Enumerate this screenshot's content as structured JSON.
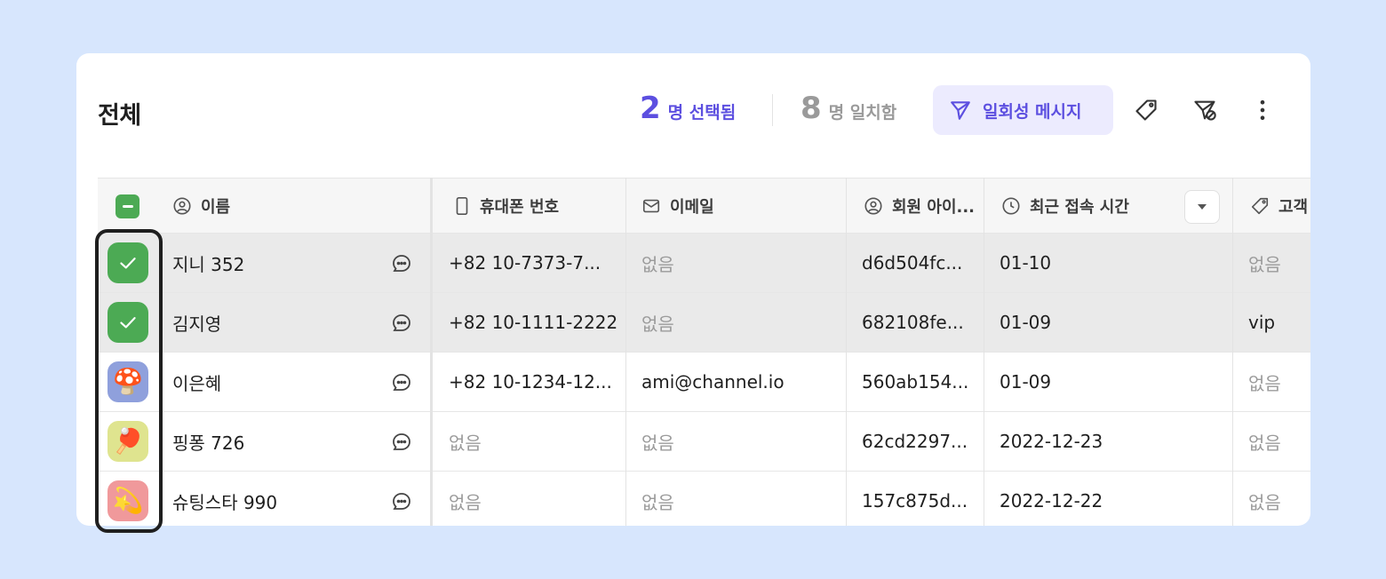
{
  "header": {
    "title": "전체",
    "selected_count": "2",
    "selected_label": "명 선택됨",
    "matched_count": "8",
    "matched_label": "명 일치함",
    "send_message_label": "일회성 메시지"
  },
  "icons": {
    "send": "paper-plane-icon",
    "tag": "tag-icon",
    "filter_send": "send-filter-icon",
    "more": "more-vertical-icon"
  },
  "colors": {
    "accent": "#5c4fe0",
    "accent_bg": "#ecebfe",
    "check_green": "#4caa54",
    "page_bg": "#d7e6fd"
  },
  "table": {
    "columns": [
      {
        "label": "이름",
        "icon": "user-circle-icon"
      },
      {
        "label": "휴대폰 번호",
        "icon": "phone-icon"
      },
      {
        "label": "이메일",
        "icon": "mail-icon"
      },
      {
        "label": "회원 아이...",
        "icon": "user-circle-icon"
      },
      {
        "label": "최근 접속 시간",
        "icon": "clock-icon"
      },
      {
        "label": "고객",
        "icon": "tag-icon"
      }
    ],
    "rows": [
      {
        "selected": true,
        "avatar": "check",
        "name": "지니 352",
        "phone": "+82 10-7373-7...",
        "email": "없음",
        "member_id": "d6d504fc...",
        "last_seen": "01-10",
        "tag": "없음"
      },
      {
        "selected": true,
        "avatar": "check",
        "name": "김지영",
        "phone": "+82 10-1111-2222",
        "email": "없음",
        "member_id": "682108fe...",
        "last_seen": "01-09",
        "tag": "vip"
      },
      {
        "selected": false,
        "avatar": "🍄",
        "name": "이은혜",
        "phone": "+82 10-1234-12...",
        "email": "ami@channel.io",
        "member_id": "560ab154...",
        "last_seen": "01-09",
        "tag": "없음"
      },
      {
        "selected": false,
        "avatar": "🏓",
        "name": "핑퐁 726",
        "phone": "없음",
        "email": "없음",
        "member_id": "62cd2297...",
        "last_seen": "2022-12-23",
        "tag": "없음"
      },
      {
        "selected": false,
        "avatar": "💫",
        "name": "슈팅스타 990",
        "phone": "없음",
        "email": "없음",
        "member_id": "157c875d...",
        "last_seen": "2022-12-22",
        "tag": "없음"
      }
    ]
  }
}
